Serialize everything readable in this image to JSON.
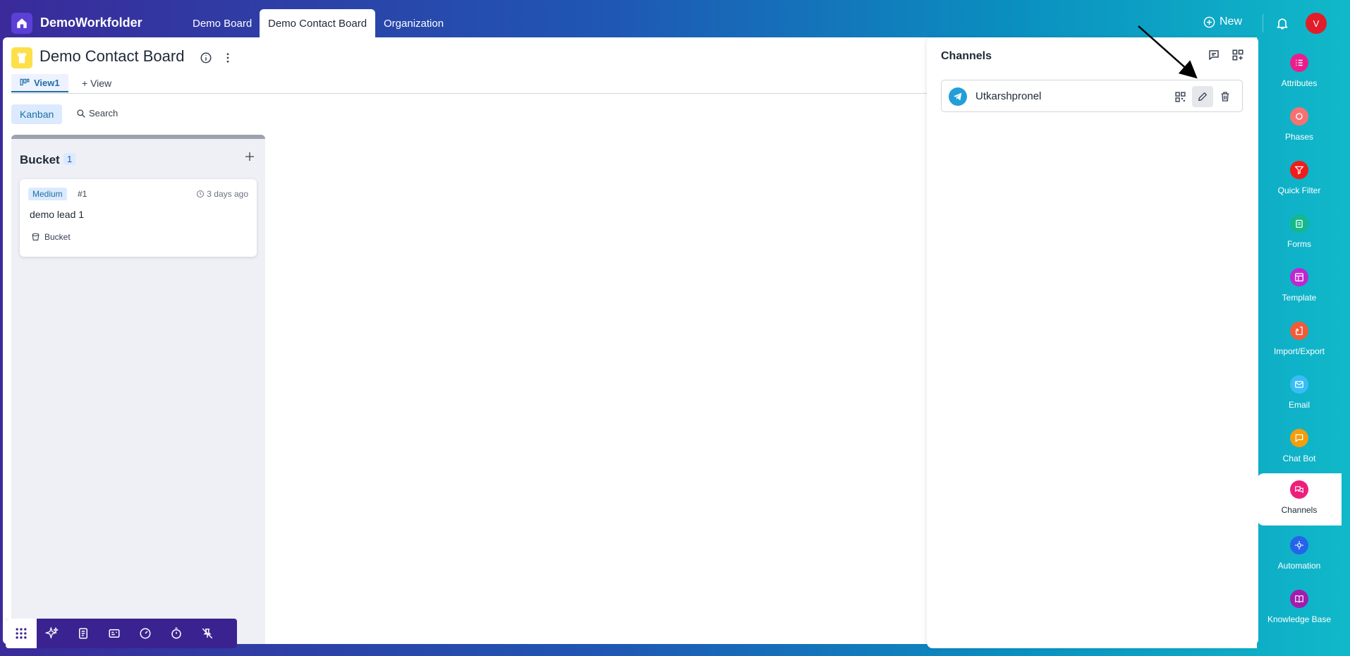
{
  "topbar": {
    "workspace": "DemoWorkfolder",
    "tabs": [
      {
        "label": "Demo Board"
      },
      {
        "label": "Demo Contact Board"
      },
      {
        "label": "Organization"
      }
    ],
    "new_label": "New",
    "avatar_initial": "V"
  },
  "board": {
    "title": "Demo Contact Board",
    "view_tab": "View1",
    "add_view": "+ View",
    "kanban_label": "Kanban",
    "search_label": "Search"
  },
  "column": {
    "title": "Bucket",
    "count": "1",
    "card": {
      "priority": "Medium",
      "id": "#1",
      "time": "3 days ago",
      "title": "demo lead 1",
      "bucket": "Bucket"
    }
  },
  "channels": {
    "title": "Channels",
    "items": [
      {
        "name": "Utkarshpronel"
      }
    ]
  },
  "sidebar": {
    "items": [
      {
        "label": "Attributes",
        "icon": "attributes-icon",
        "color": "#e91e8c"
      },
      {
        "label": "Phases",
        "icon": "phases-icon",
        "color": "#f87171"
      },
      {
        "label": "Quick Filter",
        "icon": "filter-icon",
        "color": "#ef1c1c"
      },
      {
        "label": "Forms",
        "icon": "forms-icon",
        "color": "#14b88a"
      },
      {
        "label": "Template",
        "icon": "template-icon",
        "color": "#c026d3"
      },
      {
        "label": "Import/Export",
        "icon": "import-export-icon",
        "color": "#f25b3a"
      },
      {
        "label": "Email",
        "icon": "email-icon",
        "color": "#38bdf8"
      },
      {
        "label": "Chat Bot",
        "icon": "chatbot-icon",
        "color": "#f59e0b"
      },
      {
        "label": "Channels",
        "icon": "channels-icon",
        "color": "#ec1f7a"
      },
      {
        "label": "Automation",
        "icon": "automation-icon",
        "color": "#2563eb"
      },
      {
        "label": "Knowledge Base",
        "icon": "knowledge-base-icon",
        "color": "#a21caf"
      }
    ]
  },
  "colors": {
    "accent": "#1d6fa5",
    "brand": "#3a2391"
  }
}
